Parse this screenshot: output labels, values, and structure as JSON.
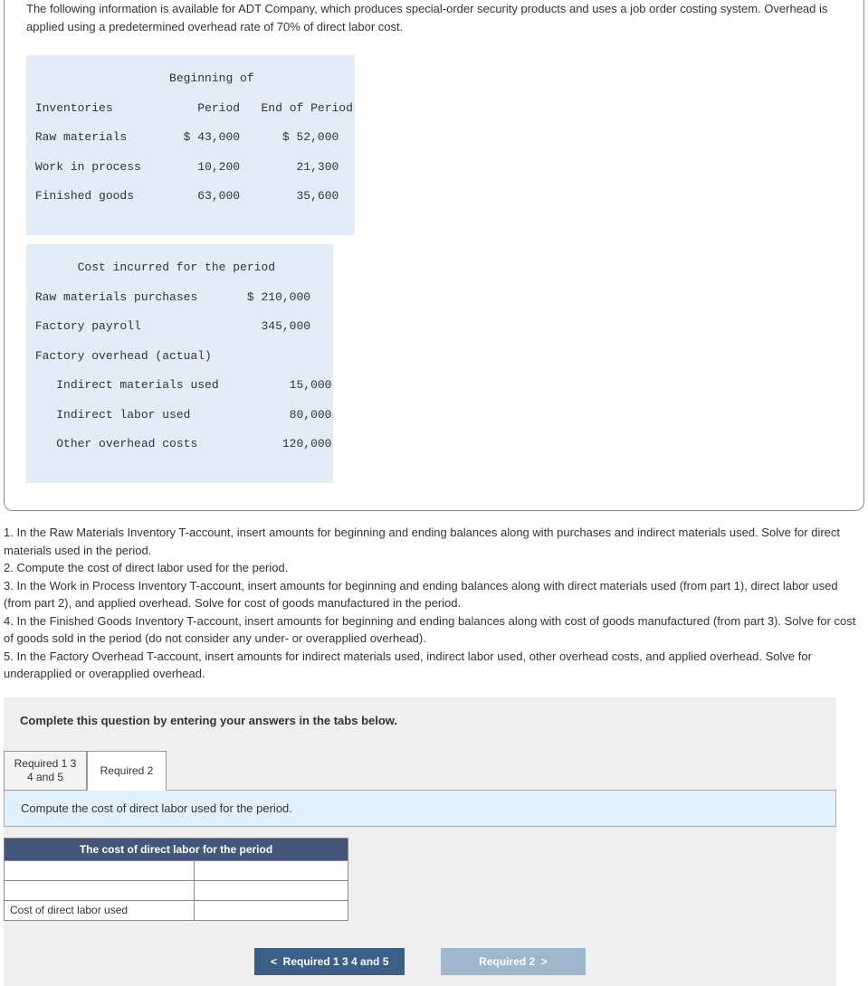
{
  "intro": "The following information is available for ADT Company, which produces special-order security products and uses a job order costing system. Overhead is applied using a predetermined overhead rate of 70% of direct labor cost.",
  "inv_table": {
    "h_blank": "              ",
    "h_beg": "Beginning of",
    "h_inv": "Inventories",
    "h_per": "Period",
    "h_end": "End of Period",
    "r1_label": "Raw materials",
    "r1_beg": "$ 43,000",
    "r1_end": "$ 52,000",
    "r2_label": "Work in process",
    "r2_beg": "10,200",
    "r2_end": "21,300",
    "r3_label": "Finished goods",
    "r3_beg": "63,000",
    "r3_end": "35,600"
  },
  "cost_table": {
    "h": "Cost incurred for the period",
    "r1_label": "Raw materials purchases",
    "r1_val": "$ 210,000",
    "r2_label": "Factory payroll",
    "r2_val": "345,000",
    "r3_label": "Factory overhead (actual)",
    "r4_label": "Indirect materials used",
    "r4_val": "15,000",
    "r5_label": "Indirect labor used",
    "r5_val": "80,000",
    "r6_label": "Other overhead costs",
    "r6_val": "120,000"
  },
  "instructions": {
    "i1": "1. In the Raw Materials Inventory T-account, insert amounts for beginning and ending balances along with purchases and indirect materials used. Solve for direct materials used in the period.",
    "i2": "2. Compute the cost of direct labor used for the period.",
    "i3": "3. In the Work in Process Inventory T-account, insert amounts for beginning and ending balances along with direct materials used (from part 1), direct labor used (from part 2), and applied overhead. Solve for cost of goods manufactured in the period.",
    "i4": "4. In the Finished Goods Inventory T-account, insert amounts for beginning and ending balances along with cost of goods manufactured (from part 3). Solve for cost of goods sold in the period (do not consider any under- or overapplied overhead).",
    "i5": "5. In the Factory Overhead T-account, insert amounts for indirect materials used, indirect labor used, other overhead costs, and applied overhead. Solve for underapplied or overapplied overhead."
  },
  "answer": {
    "prompt": "Complete this question by entering your answers in the tabs below.",
    "tab1": "Required 1 3 4 and 5",
    "tab2": "Required 2",
    "tab_instruction": "Compute the cost of direct labor used for the period.",
    "ws_header": "The cost of direct labor for the period",
    "ws_row3_label": "Cost of direct labor used"
  },
  "nav": {
    "prev_chev": "<",
    "prev": "Required 1 3 4 and 5",
    "next": "Required 2",
    "next_chev": ">"
  }
}
